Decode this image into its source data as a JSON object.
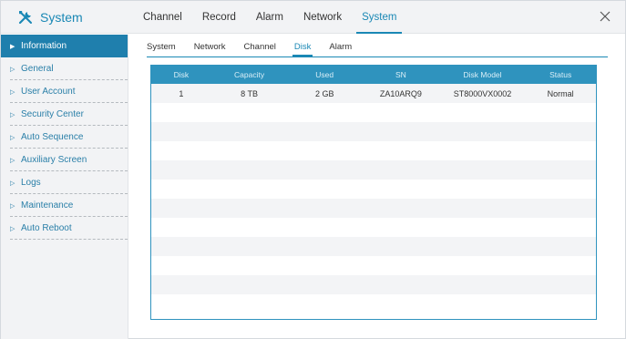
{
  "app": {
    "title": "System",
    "icon": "tools-icon"
  },
  "main_tabs": [
    {
      "label": "Channel",
      "active": false
    },
    {
      "label": "Record",
      "active": false
    },
    {
      "label": "Alarm",
      "active": false
    },
    {
      "label": "Network",
      "active": false
    },
    {
      "label": "System",
      "active": true
    }
  ],
  "sidebar": {
    "items": [
      {
        "label": "Information",
        "active": true
      },
      {
        "label": "General",
        "active": false
      },
      {
        "label": "User Account",
        "active": false
      },
      {
        "label": "Security Center",
        "active": false
      },
      {
        "label": "Auto Sequence",
        "active": false
      },
      {
        "label": "Auxiliary Screen",
        "active": false
      },
      {
        "label": "Logs",
        "active": false
      },
      {
        "label": "Maintenance",
        "active": false
      },
      {
        "label": "Auto Reboot",
        "active": false
      }
    ]
  },
  "sub_tabs": [
    {
      "label": "System",
      "active": false
    },
    {
      "label": "Network",
      "active": false
    },
    {
      "label": "Channel",
      "active": false
    },
    {
      "label": "Disk",
      "active": true
    },
    {
      "label": "Alarm",
      "active": false
    }
  ],
  "disk_table": {
    "headers": [
      "Disk",
      "Capacity",
      "Used",
      "SN",
      "Disk Model",
      "Status"
    ],
    "rows": [
      [
        "1",
        "8 TB",
        "2 GB",
        "ZA10ARQ9",
        "ST8000VX0002",
        "Normal"
      ]
    ]
  },
  "colors": {
    "accent": "#1a88b5",
    "sidebar_active": "#1f7fad",
    "table_header": "#2f93be"
  }
}
